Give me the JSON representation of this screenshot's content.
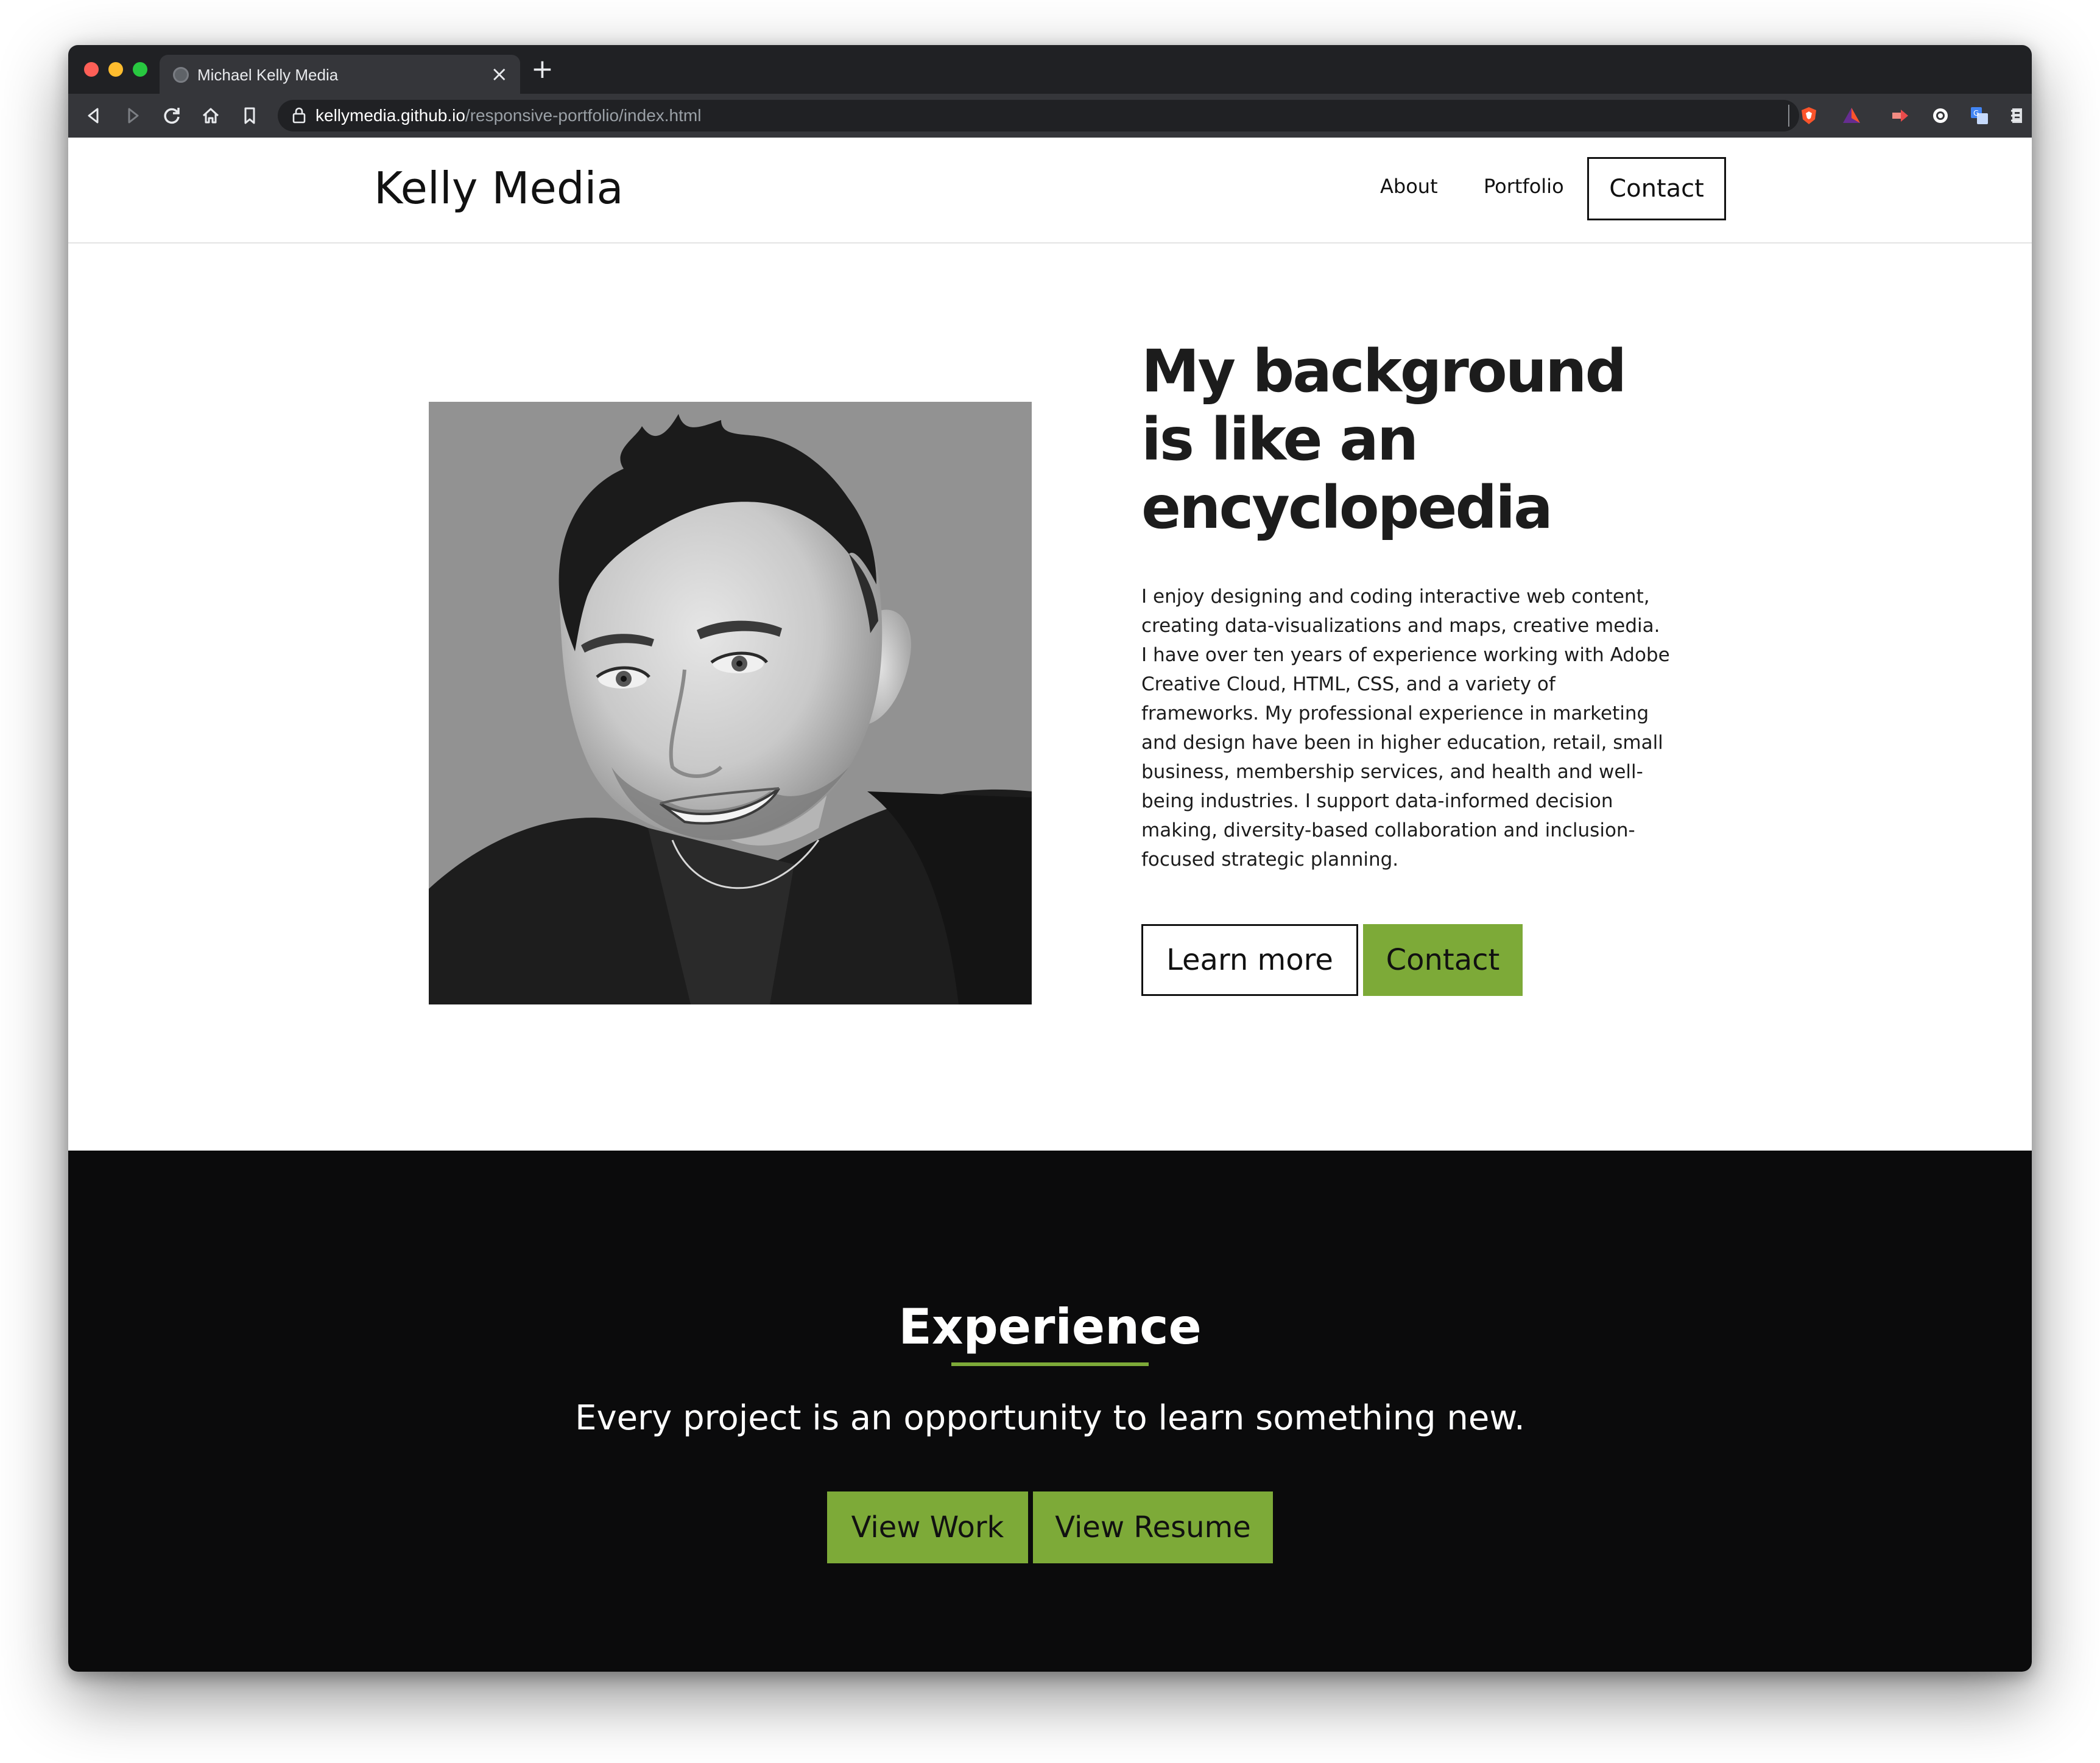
{
  "browser": {
    "tab_title": "Michael Kelly Media",
    "tab_close": "×",
    "new_tab": "+",
    "url_host": "kellymedia.github.io",
    "url_path": "/responsive-portfolio/index.html",
    "icons": [
      "back-icon",
      "forward-icon",
      "reload-icon",
      "home-icon",
      "bookmark-icon",
      "lock-icon",
      "menu-icon"
    ],
    "extension_icons": [
      "brave-shield-icon",
      "brave-rewards-icon",
      "extension-arrow-icon",
      "extension-circle-icon",
      "translate-icon",
      "extension-doc-icon"
    ]
  },
  "header": {
    "brand": "Kelly Media",
    "nav": {
      "about": "About",
      "portfolio": "Portfolio",
      "contact": "Contact"
    }
  },
  "hero": {
    "heading_line1": "My background",
    "heading_line2": "is like an",
    "heading_line3": "encyclopedia",
    "body": "I enjoy designing and coding interactive web content, creating data-visualizations and maps, creative media. I have over ten years of experience working with Adobe Creative Cloud, HTML, CSS, and a variety of frameworks. My professional experience in marketing and design have been in higher education, retail, small business, membership services, and health and well-being industries. I support data-informed decision making, diversity-based collaboration and inclusion-focused strategic planning.",
    "learn_more": "Learn more",
    "contact": "Contact"
  },
  "experience": {
    "title": "Experience",
    "subtitle": "Every project is an opportunity to learn something new.",
    "view_work": "View Work",
    "view_resume": "View Resume"
  },
  "colors": {
    "accent_green": "#7daa38",
    "dark_section": "#0b0b0c",
    "text_dark": "#1c1c1c",
    "browser_chrome": "#35363a"
  }
}
